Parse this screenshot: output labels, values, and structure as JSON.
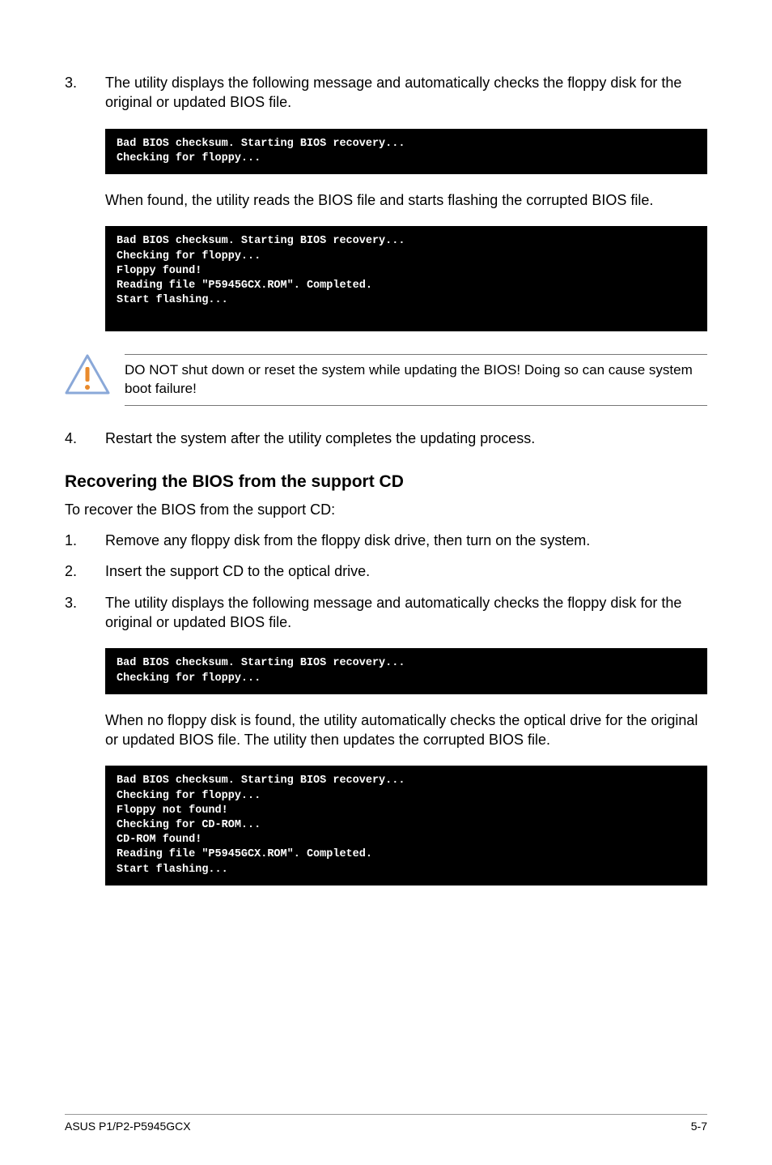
{
  "step3": {
    "num": "3.",
    "text": "The utility displays the following message and automatically checks the floppy disk for the original or updated BIOS file."
  },
  "terminal1": "Bad BIOS checksum. Starting BIOS recovery...\nChecking for floppy...",
  "para_found": "When found, the utility reads the BIOS file and starts flashing the corrupted BIOS file.",
  "terminal2": "Bad BIOS checksum. Starting BIOS recovery...\nChecking for floppy...\nFloppy found!\nReading file \"P5945GCX.ROM\". Completed.\nStart flashing...\n\n",
  "note_text": "DO NOT shut down or reset the system while updating the BIOS! Doing so can cause system boot failure!",
  "step4": {
    "num": "4.",
    "text": "Restart the system after the utility completes the updating process."
  },
  "heading": "Recovering the BIOS from the support CD",
  "intro": "To recover the BIOS from the support CD:",
  "cd_step1": {
    "num": "1.",
    "text": "Remove any floppy disk from the floppy disk drive, then turn on the system."
  },
  "cd_step2": {
    "num": "2.",
    "text": "Insert the support CD to the optical drive."
  },
  "cd_step3": {
    "num": "3.",
    "text": "The utility displays the following message and automatically checks the floppy disk for the original or updated BIOS file."
  },
  "terminal3": "Bad BIOS checksum. Starting BIOS recovery...\nChecking for floppy...",
  "para_no_floppy": "When no floppy disk is found, the utility automatically checks the optical drive for the original or updated BIOS file. The utility then updates the corrupted BIOS file.",
  "terminal4": "Bad BIOS checksum. Starting BIOS recovery...\nChecking for floppy...\nFloppy not found!\nChecking for CD-ROM...\nCD-ROM found!\nReading file \"P5945GCX.ROM\". Completed.\nStart flashing...\n",
  "footer_left": "ASUS P1/P2-P5945GCX",
  "footer_right": "5-7"
}
